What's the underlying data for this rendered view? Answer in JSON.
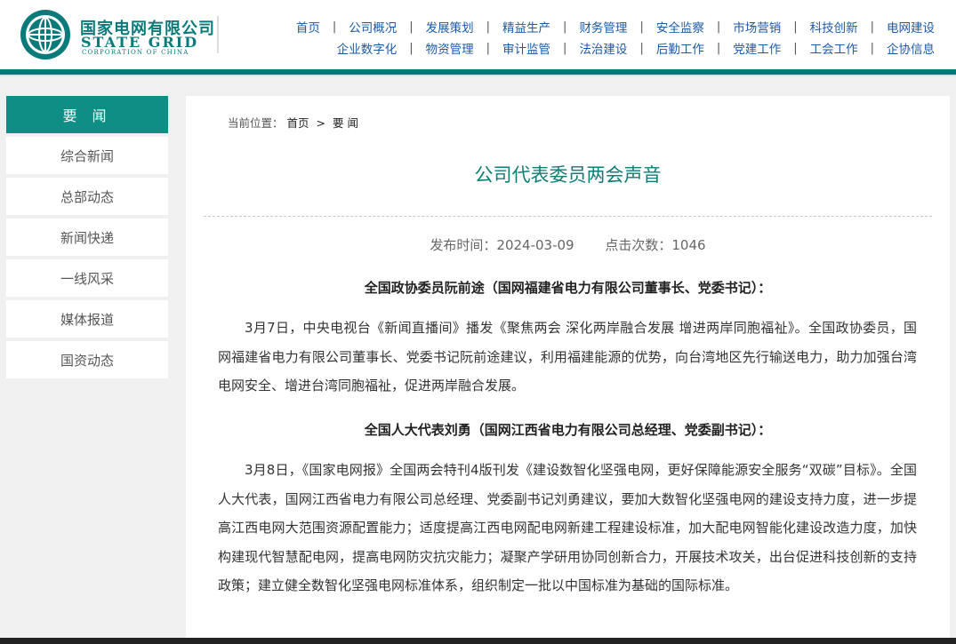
{
  "header": {
    "logo_cn": "国家电网有限公司",
    "logo_en": "STATE GRID",
    "logo_sub": "CORPORATION OF CHINA",
    "brand_color": "#0b7a7a",
    "nav_row1": [
      "首页",
      "公司概况",
      "发展策划",
      "精益生产",
      "财务管理",
      "安全监察",
      "市场营销",
      "科技创新",
      "电网建设"
    ],
    "nav_row2": [
      "企业数字化",
      "物资管理",
      "审计监管",
      "法治建设",
      "后勤工作",
      "党建工作",
      "工会工作",
      "企协信息"
    ]
  },
  "sidebar": {
    "title": "要 闻",
    "items": [
      "综合新闻",
      "总部动态",
      "新闻快递",
      "一线风采",
      "媒体报道",
      "国资动态"
    ],
    "accent": "#0f8e86"
  },
  "breadcrumb": {
    "prefix": "当前位置：",
    "home": "首页",
    "arrow": ">",
    "current": "要闻"
  },
  "article": {
    "title": "公司代表委员两会声音",
    "publish_label": "发布时间：2024-03-09",
    "views_label": "点击次数：1046",
    "section1_head": "全国政协委员阮前途（国网福建省电力有限公司董事长、党委书记）：",
    "section1_body": "3月7日，中央电视台《新闻直播间》播发《聚焦两会 深化两岸融合发展 增进两岸同胞福祉》。全国政协委员，国网福建省电力有限公司董事长、党委书记阮前途建议，利用福建能源的优势，向台湾地区先行输送电力，助力加强台湾电网安全、增进台湾同胞福祉，促进两岸融合发展。",
    "section2_head": "全国人大代表刘勇（国网江西省电力有限公司总经理、党委副书记）：",
    "section2_body": "3月8日，《国家电网报》全国两会特刊4版刊发《建设数智化坚强电网，更好保障能源安全服务“双碳”目标》。全国人大代表，国网江西省电力有限公司总经理、党委副书记刘勇建议，要加大数智化坚强电网的建设支持力度，进一步提高江西电网大范围资源配置能力；适度提高江西电网配电网新建工程建设标准，加大配电网智能化建设改造力度，加快构建现代智慧配电网，提高电网防灾抗灾能力；凝聚产学研用协同创新合力，开展技术攻关，出台促进科技创新的支持政策；建立健全数智化坚强电网标准体系，组织制定一批以中国标准为基础的国际标准。"
  }
}
